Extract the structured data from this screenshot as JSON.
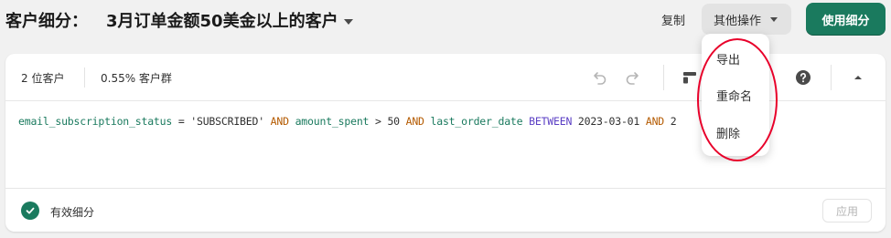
{
  "header": {
    "title_label": "客户细分：",
    "segment_name": "3月订单金额50美金以上的客户",
    "copy_label": "复制",
    "more_actions_label": "其他操作",
    "use_segment_label": "使用细分"
  },
  "more_menu": {
    "items": [
      {
        "label": "导出"
      },
      {
        "label": "重命名"
      },
      {
        "label": "删除"
      }
    ]
  },
  "stats": {
    "customer_count": "2 位客户",
    "percent": "0.55% 客户群"
  },
  "query": {
    "field1": "email_subscription_status",
    "op1": " = ",
    "str1": "'SUBSCRIBED'",
    "and1": " AND ",
    "field2": "amount_spent",
    "op2": " > ",
    "num1": "50",
    "and2": " AND ",
    "field3": "last_order_date",
    "between": " BETWEEN ",
    "date1": "2023-03-01",
    "and3": " AND ",
    "rest": "2"
  },
  "footer": {
    "status_label": "有效细分",
    "apply_label": "应用"
  },
  "colors": {
    "primary": "#1a7a5e",
    "annotation": "#e8002a",
    "keyword": "#b45a00",
    "keyword_between": "#5b3fc4"
  },
  "icons": [
    "undo-icon",
    "redo-icon",
    "layout-icon",
    "help-icon",
    "collapse-icon",
    "checkmark-icon"
  ]
}
